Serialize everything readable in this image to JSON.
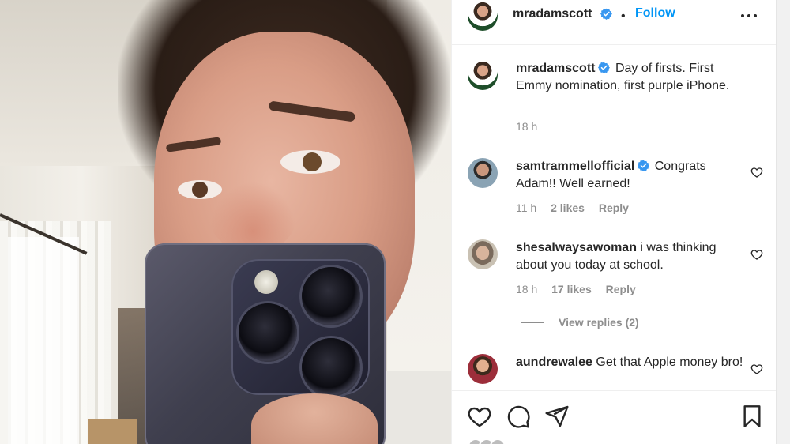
{
  "post": {
    "author": "mradamscott",
    "verified": true,
    "follow_label": "Follow",
    "separator": "•"
  },
  "caption": {
    "username": "mradamscott",
    "text": "Day of firsts. First Emmy nomination, first purple iPhone.",
    "time": "18 h"
  },
  "comments": [
    {
      "username": "samtrammellofficial",
      "verified": true,
      "text": "Congrats Adam!! Well earned!",
      "time": "11 h",
      "likes": "2 likes",
      "reply": "Reply"
    },
    {
      "username": "shesalwaysawoman",
      "verified": false,
      "text": "i was thinking about you today at school.",
      "time": "18 h",
      "likes": "17 likes",
      "reply": "Reply",
      "view_replies": "View replies (2)"
    },
    {
      "username": "aundrewalee",
      "verified": false,
      "text": "Get that Apple money bro!"
    }
  ],
  "icons": {
    "more": "more-options-icon",
    "verified": "verified-badge-icon",
    "like": "heart-icon",
    "comment": "comment-icon",
    "share": "share-icon",
    "save": "bookmark-icon"
  },
  "colors": {
    "accent": "#0095f6",
    "verified": "#3897f0",
    "secondary_text": "#8e8e8e"
  }
}
